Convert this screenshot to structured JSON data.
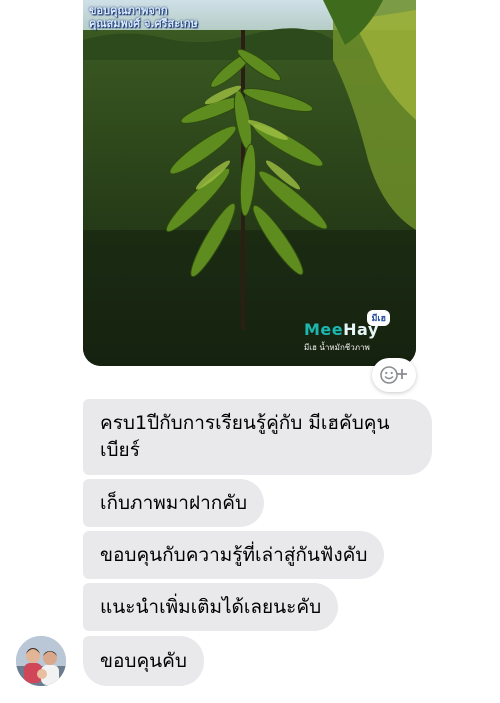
{
  "photo": {
    "credit_line1": "ขอบคุณภาพจาก",
    "credit_line2": "คุณสมพงศ์ จ.ศรีสะเกษ",
    "subject": "young durian tree",
    "logo": {
      "word_a": "Mee",
      "word_b": "Hay",
      "badge": "มีเฮ",
      "tagline": "มีเฮ น้ำหมักชีวภาพ"
    }
  },
  "reaction_button": {
    "icon": "add-emoji-icon"
  },
  "messages": [
    {
      "text": "ครบ1ปีกับการเรียนรู้คู่กับ มีเฮคับคุนเบียร์"
    },
    {
      "text": "เก็บภาพมาฝากคับ"
    },
    {
      "text": "ขอบคุนกับความรู้ที่เล่าสู่กันฟังคับ"
    },
    {
      "text": "แนะนำเพิ่มเติมได้เลยนะคับ"
    },
    {
      "text": "ขอบคุนคับ"
    }
  ],
  "sender_avatar": {
    "icon": "profile-photo"
  }
}
